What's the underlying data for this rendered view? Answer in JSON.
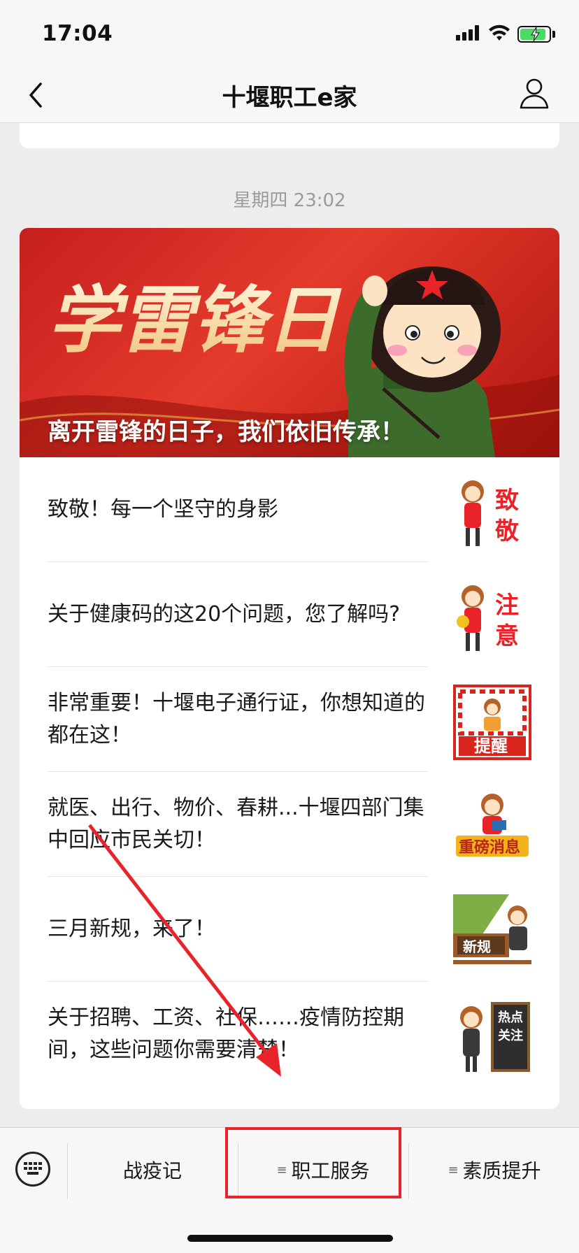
{
  "status_bar": {
    "time": "17:04"
  },
  "nav": {
    "title": "十堰职工e家"
  },
  "chat": {
    "timestamp": "星期四 23:02",
    "banner": {
      "calligraphy": "学雷锋日",
      "headline": "离开雷锋的日子，我们依旧传承！"
    },
    "articles": [
      {
        "title": "致敬！每一个坚守的身影",
        "thumb_text": "致敬",
        "thumb_accent": "#e8242a"
      },
      {
        "title": "关于健康码的这20个问题，您了解吗?",
        "thumb_text": "注意",
        "thumb_accent": "#e8242a"
      },
      {
        "title": "非常重要！十堰电子通行证，你想知道的都在这！",
        "thumb_text": "提醒",
        "thumb_accent": "#d8261f"
      },
      {
        "title": "就医、出行、物价、春耕...十堰四部门集中回应市民关切！",
        "thumb_text": "重磅消息",
        "thumb_accent": "#f2b31c"
      },
      {
        "title": "三月新规，来了！",
        "thumb_text": "新规",
        "thumb_accent": "#6a8f3a"
      },
      {
        "title": "关于招聘、工资、社保……疫情防控期间，这些问题你需要清楚！",
        "thumb_text": "热点关注",
        "thumb_accent": "#3a3a3a"
      }
    ]
  },
  "menu": {
    "items": [
      {
        "label": "战疫记",
        "has_submenu": false
      },
      {
        "label": "职工服务",
        "has_submenu": true
      },
      {
        "label": "素质提升",
        "has_submenu": true
      }
    ],
    "submenu_glyph": "≡"
  },
  "annotation": {
    "highlight_color": "#e8242a"
  }
}
